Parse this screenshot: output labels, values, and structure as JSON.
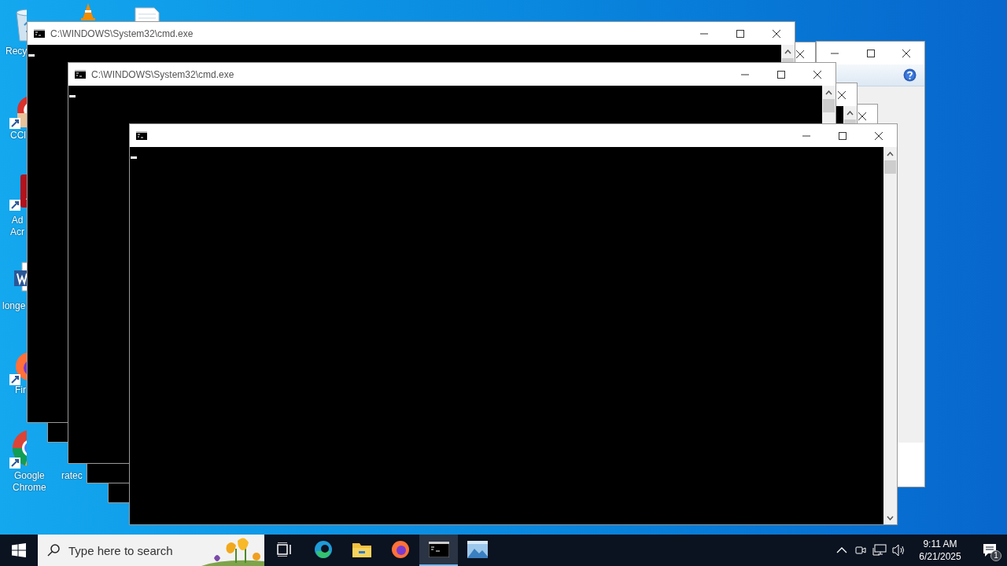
{
  "desktop_icons": [
    {
      "kind": "recycle-bin",
      "lines": [
        "Recy"
      ]
    },
    {
      "kind": "ccleaner",
      "lines": [
        "CCl"
      ]
    },
    {
      "kind": "acrobat",
      "lines": [
        "Ad",
        "Acr"
      ]
    },
    {
      "kind": "word",
      "lines": [
        "longe"
      ]
    },
    {
      "kind": "firefox",
      "lines": [
        "Fir"
      ]
    },
    {
      "kind": "chrome",
      "lines": [
        "Google",
        "Chrome"
      ]
    },
    {
      "kind": "text",
      "lines": [
        "ratec"
      ]
    },
    {
      "kind": "vlc"
    },
    {
      "kind": "file"
    }
  ],
  "windows": [
    {
      "kind": "dialog"
    },
    {
      "kind": "console-back"
    },
    {
      "kind": "console-back"
    },
    {
      "kind": "console-back"
    },
    {
      "kind": "console",
      "title": "C:\\WINDOWS\\System32\\cmd.exe"
    },
    {
      "kind": "console",
      "title": "C:\\WINDOWS\\System32\\cmd.exe"
    },
    {
      "kind": "console"
    }
  ],
  "taskbar": {
    "search": {
      "placeholder": "Type here to search"
    },
    "apps": [
      {
        "kind": "task-view",
        "selected": false
      },
      {
        "kind": "edge",
        "selected": false
      },
      {
        "kind": "explorer",
        "selected": false
      },
      {
        "kind": "firefox",
        "selected": false
      },
      {
        "kind": "cmd",
        "selected": true
      },
      {
        "kind": "photos",
        "selected": false
      }
    ],
    "clock": {
      "time": "9:11 AM",
      "date": "6/21/2025"
    },
    "notifications": {
      "count": "1"
    }
  }
}
